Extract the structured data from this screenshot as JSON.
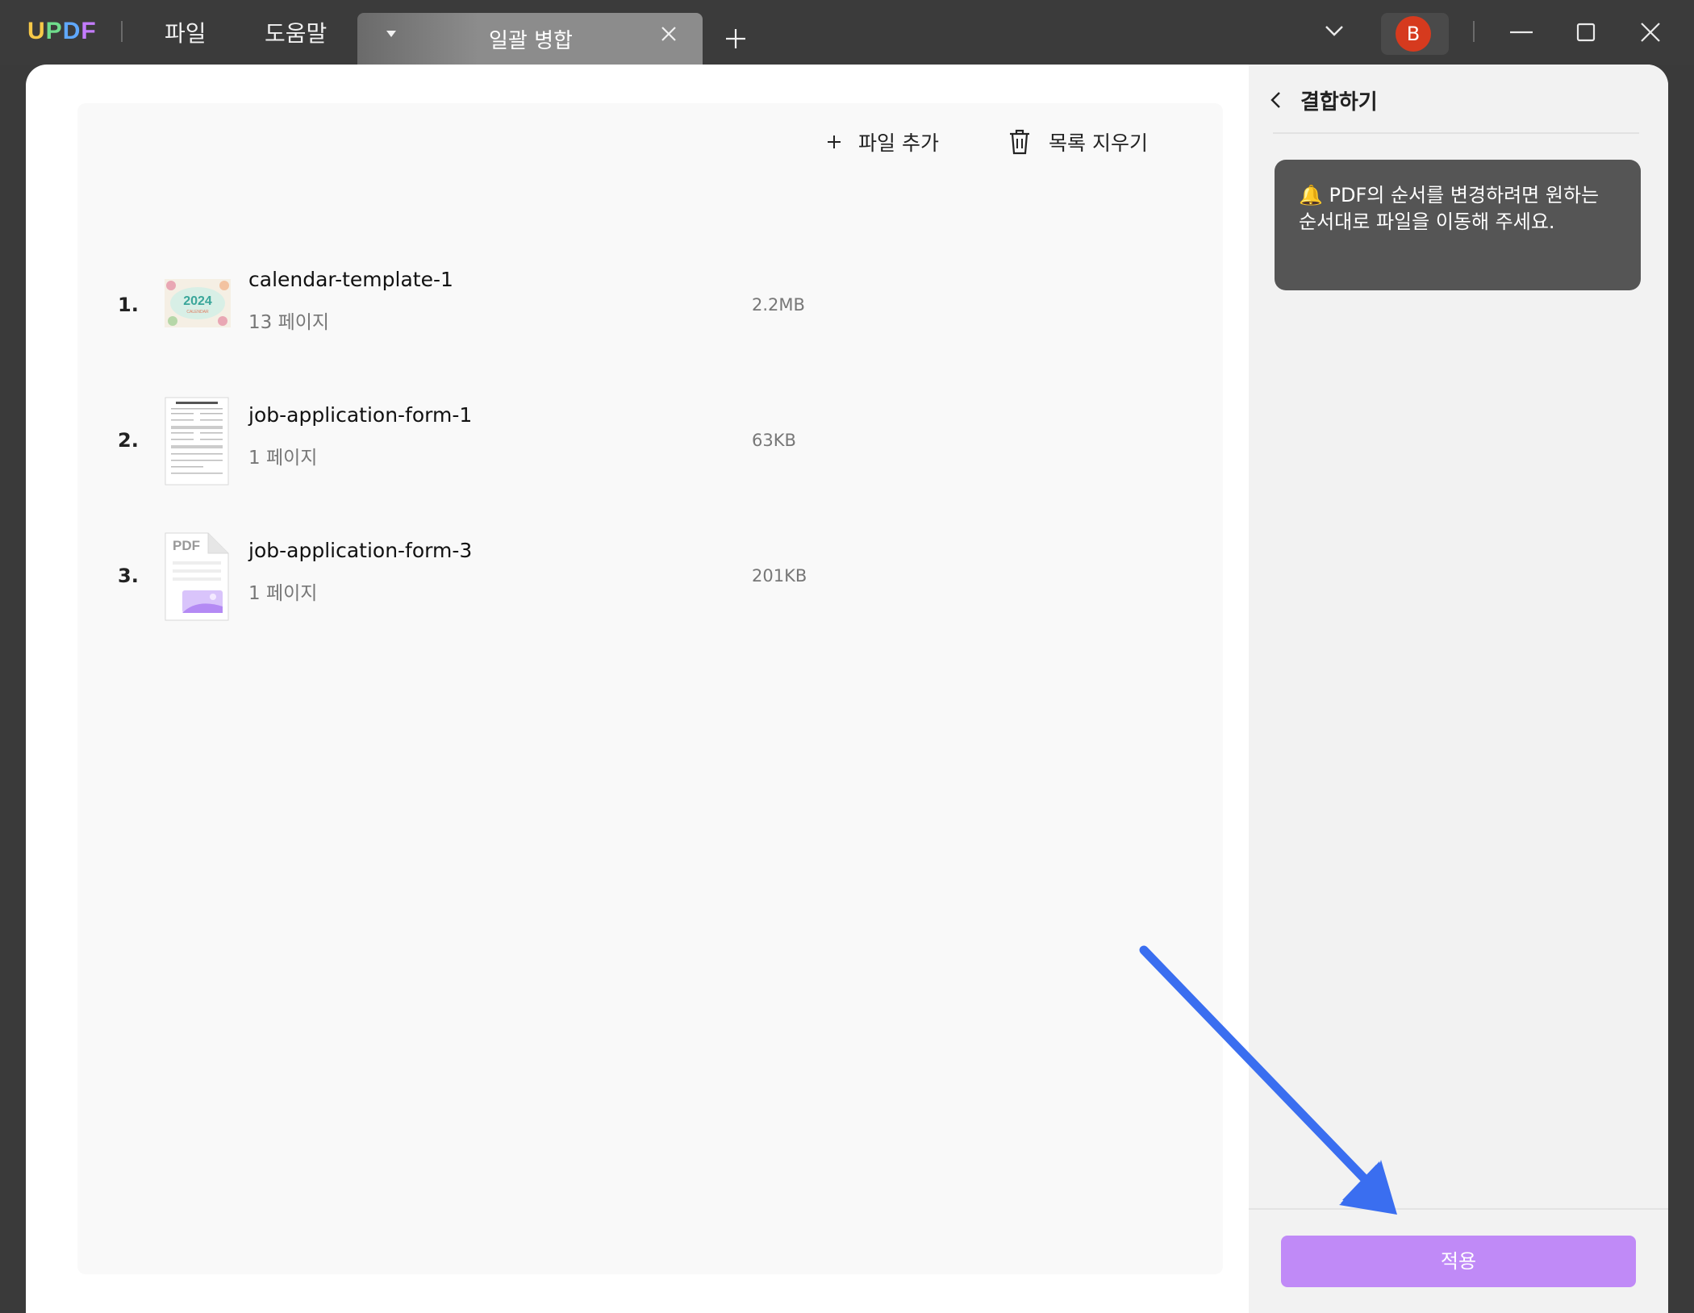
{
  "app": {
    "logo": [
      "U",
      "P",
      "D",
      "F"
    ]
  },
  "menu": {
    "file": "파일",
    "help": "도움말"
  },
  "tab": {
    "title": "일괄 병합"
  },
  "user": {
    "avatar_initial": "B"
  },
  "toolbar": {
    "add_file": "파일 추가",
    "clear_list": "목록 지우기"
  },
  "files": [
    {
      "index": "1.",
      "name": "calendar-template-1",
      "pages": "13 페이지",
      "size": "2.2MB",
      "thumb_text": "2024",
      "thumb_subtext": "CALENDAR"
    },
    {
      "index": "2.",
      "name": "job-application-form-1",
      "pages": "1 페이지",
      "size": "63KB"
    },
    {
      "index": "3.",
      "name": "job-application-form-3",
      "pages": "1 페이지",
      "size": "201KB",
      "thumb_text": "PDF"
    }
  ],
  "sidebar": {
    "title": "결합하기",
    "tip": "🔔 PDF의 순서를 변경하려면 원하는 순서대로 파일을 이동해 주세요.",
    "apply": "적용"
  },
  "colors": {
    "accent": "#c08af7",
    "arrow": "#3a6ef0",
    "avatar": "#d63a1e"
  }
}
